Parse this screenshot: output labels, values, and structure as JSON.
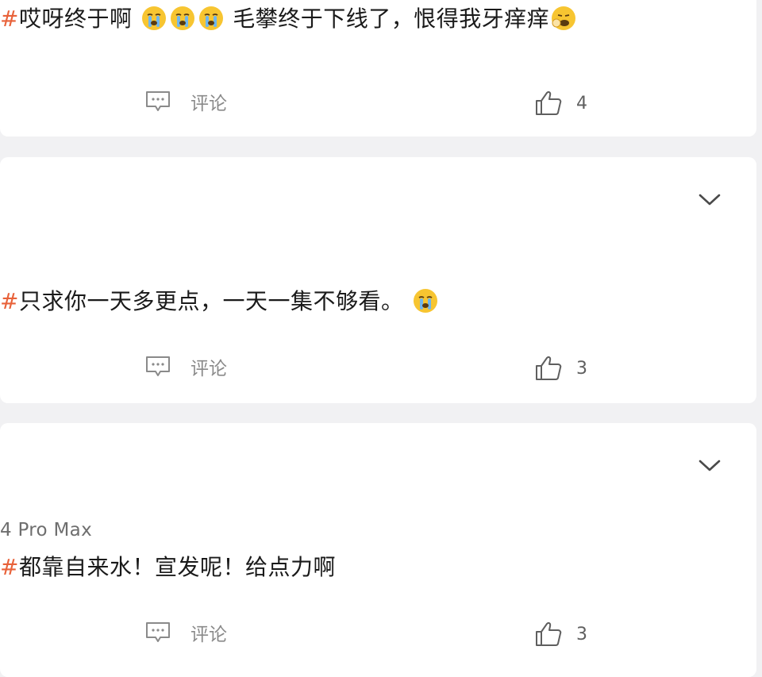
{
  "posts": [
    {
      "hash": "#",
      "text_a": "哎呀终于啊",
      "emojis_a": [
        "crying-face",
        "crying-face",
        "crying-face"
      ],
      "text_b": "毛攀终于下线了，恨得我牙痒痒",
      "emojis_b": [
        "yawning-face"
      ],
      "comment_label": "评论",
      "like_count": "4"
    },
    {
      "hash": "#",
      "text_a": "只求你一天多更点，一天一集不够看。",
      "emojis_a": [
        "crying-face"
      ],
      "comment_label": "评论",
      "like_count": "3"
    },
    {
      "device": "4 Pro Max",
      "hash": "#",
      "text_a": "都靠自来水！宣发呢！给点力啊",
      "comment_label": "评论",
      "like_count": "3"
    }
  ],
  "colors": {
    "hash": "#e8623a",
    "background": "#f1f1f3",
    "card": "#ffffff"
  }
}
